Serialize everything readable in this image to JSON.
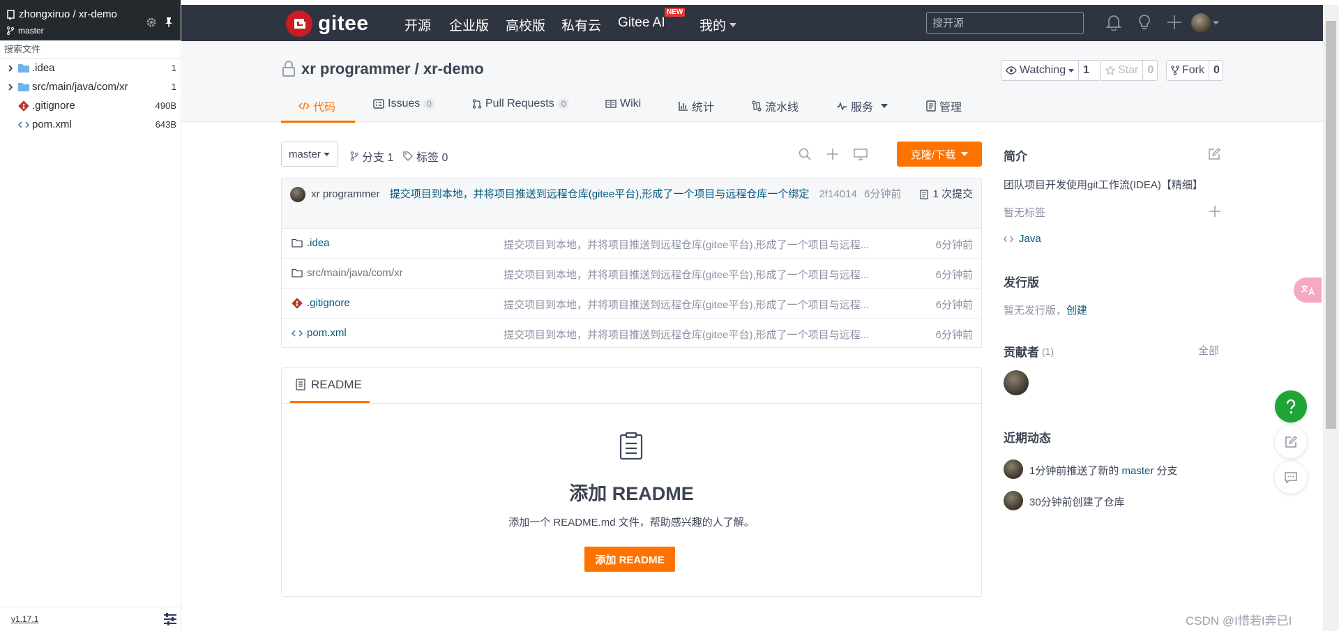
{
  "sidebar": {
    "repo_path": "zhongxiruo / xr-demo",
    "branch": "master",
    "search_label": "搜索文件",
    "files": [
      {
        "name": ".idea",
        "type": "folder",
        "size": "1"
      },
      {
        "name": "src/main/java/com/xr",
        "type": "folder",
        "size": "1"
      },
      {
        "name": ".gitignore",
        "type": "git",
        "size": "490B"
      },
      {
        "name": "pom.xml",
        "type": "code",
        "size": "643B"
      }
    ],
    "version": "v1.17.1"
  },
  "nav": {
    "logo_text": "gitee",
    "links": [
      "开源",
      "企业版",
      "高校版",
      "私有云",
      "Gitee AI",
      "我的"
    ],
    "new_badge": "NEW",
    "search_placeholder": "搜开源"
  },
  "repo": {
    "title": "xr programmer / xr-demo",
    "watching_label": "Watching",
    "watching_count": "1",
    "star_label": "Star",
    "star_count": "0",
    "fork_label": "Fork",
    "fork_count": "0"
  },
  "tabs": [
    {
      "label": "代码"
    },
    {
      "label": "Issues",
      "count": "0"
    },
    {
      "label": "Pull Requests",
      "count": "0"
    },
    {
      "label": "Wiki"
    },
    {
      "label": "统计"
    },
    {
      "label": "流水线"
    },
    {
      "label": "服务"
    },
    {
      "label": "管理"
    }
  ],
  "branch_bar": {
    "branch": "master",
    "branches": "分支 1",
    "tags": "标签 0",
    "clone_label": "克隆/下载"
  },
  "last_commit": {
    "author": "xr programmer",
    "message": "提交项目到本地，并将项目推送到远程仓库(gitee平台),形成了一个项目与远程仓库一个绑定",
    "hash": "2f14014",
    "time": "6分钟前",
    "commits": "1 次提交"
  },
  "files": [
    {
      "name": ".idea",
      "type": "folder",
      "message": "提交项目到本地，并将项目推送到远程仓库(gitee平台),形成了一个项目与远程...",
      "time": "6分钟前"
    },
    {
      "name": "src/main/java/com/xr",
      "type": "folder",
      "message": "提交项目到本地，并将项目推送到远程仓库(gitee平台),形成了一个项目与远程...",
      "time": "6分钟前"
    },
    {
      "name": ".gitignore",
      "type": "git",
      "message": "提交项目到本地，并将项目推送到远程仓库(gitee平台),形成了一个项目与远程...",
      "time": "6分钟前"
    },
    {
      "name": "pom.xml",
      "type": "code",
      "message": "提交项目到本地，并将项目推送到远程仓库(gitee平台),形成了一个项目与远程...",
      "time": "6分钟前"
    }
  ],
  "readme": {
    "tab_label": "README",
    "title": "添加 README",
    "description": "添加一个 README.md 文件，帮助感兴趣的人了解。",
    "button": "添加 README"
  },
  "side": {
    "intro_title": "简介",
    "intro_text": "团队项目开发使用git工作流(IDEA)【精细】",
    "no_tags": "暂无标签",
    "language": "Java",
    "release_title": "发行版",
    "no_release": "暂无发行版，",
    "create_link": "创建",
    "contributors_title": "贡献者",
    "contributors_count": "(1)",
    "all_link": "全部",
    "activity_title": "近期动态",
    "activity": [
      {
        "prefix": "1分钟前推送了新的 ",
        "branch": "master",
        "suffix": " 分支"
      },
      {
        "text": "30分钟前创建了仓库"
      }
    ]
  },
  "watermark": "CSDN @I惜若I奔已I",
  "colors": {
    "accent": "#fe7300",
    "nav_bg": "#2e3440",
    "link": "#005980"
  }
}
